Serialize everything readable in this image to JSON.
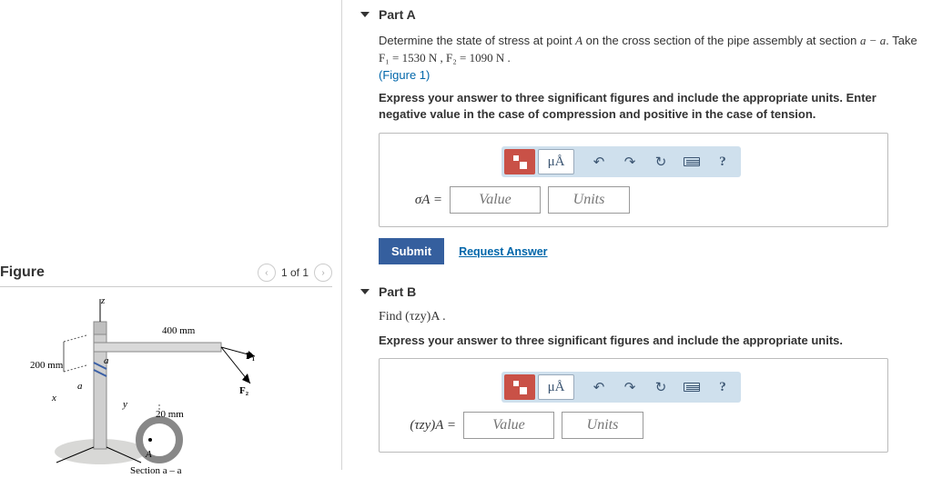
{
  "figurePanel": {
    "title": "Figure",
    "pager": "1 of 1"
  },
  "figureLabels": {
    "z": "z",
    "x": "x",
    "y": "y",
    "topArm": "400 mm",
    "vert": "200 mm",
    "rod": "20 mm",
    "f1": "F₁",
    "f2": "F₂",
    "a1": "a",
    "a2": "a",
    "a3": "A",
    "section": "Section a – a"
  },
  "partA": {
    "title": "Part A",
    "line1a": "Determine the state of stress at point ",
    "line1_A": "A",
    "line1b": " on the cross section of the pipe assembly at section ",
    "line1_aa": "a − a",
    "line1c": ". Take",
    "forces": "F₁ = 1530  N , F₂ = 1090  N .",
    "figLink": "(Figure 1)",
    "bold": "Express your answer to three significant figures and include the appropriate units. Enter negative value in the case of compression and positive in the case of tension.",
    "symbol": "σA =",
    "valuePh": "Value",
    "unitsPh": "Units",
    "muA": "μÅ",
    "submit": "Submit",
    "request": "Request Answer"
  },
  "partB": {
    "title": "Part B",
    "find": "Find (τzy)A .",
    "bold": "Express your answer to three significant figures and include the appropriate units.",
    "symbol": "(τzy)A =",
    "valuePh": "Value",
    "unitsPh": "Units",
    "muA": "μÅ"
  }
}
